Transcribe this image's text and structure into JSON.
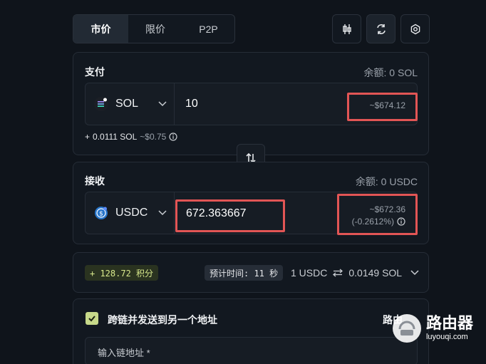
{
  "tabs": [
    "市价",
    "限价",
    "P2P"
  ],
  "pay": {
    "title": "支付",
    "balance": "余额: 0  SOL",
    "token": "SOL",
    "amount": "10",
    "usd": "~$674.12",
    "fee_plus": "+",
    "fee_amount": "0.0111 SOL",
    "fee_usd": "~$0.75"
  },
  "receive": {
    "title": "接收",
    "balance": "余额: 0 USDC",
    "token": "USDC",
    "amount": "672.363667",
    "usd": "~$672.36",
    "pct": "(-0.2612%)"
  },
  "summary": {
    "points": "+ 128.72 积分",
    "eta": "预计时间: 11 秒",
    "rate_left": "1 USDC",
    "rate_right": "0.0149 SOL"
  },
  "crosschain": {
    "label": "跨链并发送到另一个地址",
    "route": "路由",
    "placeholder": "输入链地址 *"
  },
  "watermark": {
    "title": "路由器",
    "url": "luyouqi.com"
  },
  "colors": {
    "highlight": "#e25555",
    "accent": "#c7d98a"
  }
}
